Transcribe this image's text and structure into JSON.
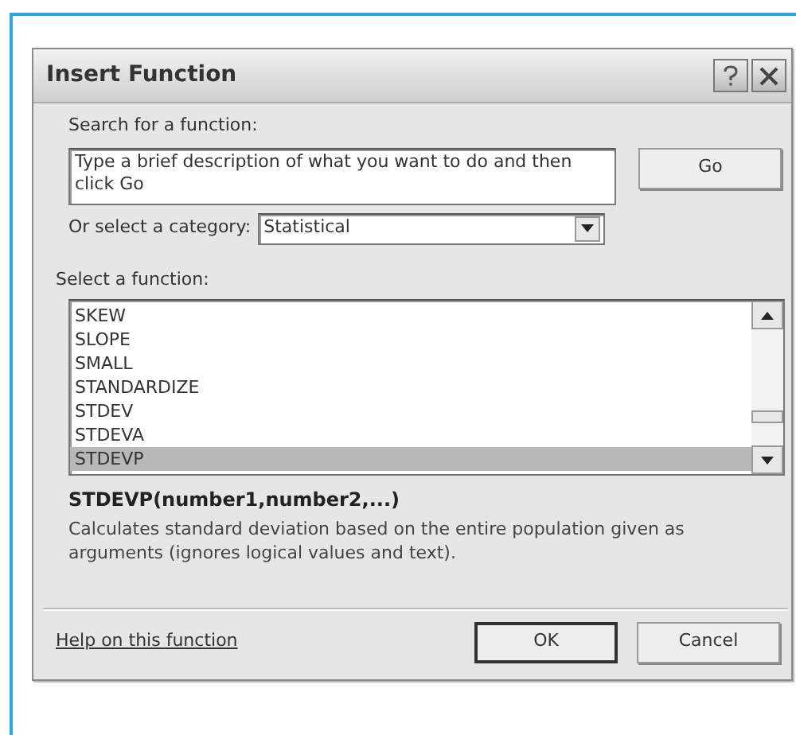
{
  "window": {
    "title": "Insert Function"
  },
  "search": {
    "label": "Search for a function:",
    "value": "Type a brief description of what you want to do and then click Go",
    "go_button": "Go"
  },
  "category": {
    "label": "Or select a category:",
    "value": "Statistical"
  },
  "function_list": {
    "label": "Select a function:",
    "items": [
      {
        "name": "SKEW",
        "selected": false
      },
      {
        "name": "SLOPE",
        "selected": false
      },
      {
        "name": "SMALL",
        "selected": false
      },
      {
        "name": "STANDARDIZE",
        "selected": false
      },
      {
        "name": "STDEV",
        "selected": false
      },
      {
        "name": "STDEVA",
        "selected": false
      },
      {
        "name": "STDEVP",
        "selected": true
      }
    ]
  },
  "signature": "STDEVP(number1,number2,...)",
  "description": "Calculates standard deviation based on the entire population given as arguments (ignores logical values and text).",
  "help_link": "Help on this function",
  "buttons": [
    "OK",
    "Cancel"
  ]
}
